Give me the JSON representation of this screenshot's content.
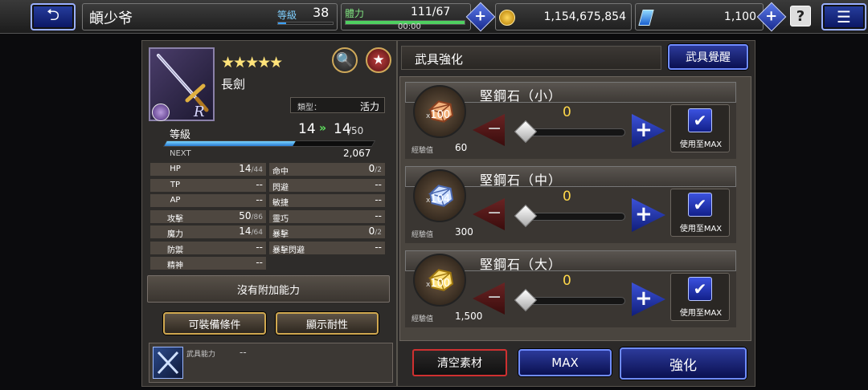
{
  "header": {
    "back_icon": "back-arrow-icon",
    "player_name": "頔少爷",
    "level_label": "等級",
    "level_value": "38",
    "exp_fraction": 0.15,
    "stamina_label": "體力",
    "stamina_value": "111/67",
    "stamina_timer": "00:00",
    "stamina_fraction": 1.0,
    "gil_value": "1,154,675,854",
    "gem_value": "1,100",
    "help_label": "?",
    "menu_icon": "hamburger-menu-icon"
  },
  "weapon": {
    "rarity_stars": "★★★★★",
    "name": "長劍",
    "type_label": "類型：",
    "type_value": "活力",
    "level_label": "等級",
    "level_current": "14",
    "level_arrow": "»",
    "level_new": "14",
    "level_max": "/50",
    "exp_fraction": 0.62,
    "next_label": "NEXT",
    "next_value": "2,067"
  },
  "stats_left": [
    {
      "label": "HP",
      "value": "14",
      "max": "/44"
    },
    {
      "label": "TP",
      "value": "--",
      "max": ""
    },
    {
      "label": "AP",
      "value": "--",
      "max": ""
    },
    {
      "label": "攻擊",
      "value": "50",
      "max": "/86"
    },
    {
      "label": "魔力",
      "value": "14",
      "max": "/64"
    },
    {
      "label": "防禦",
      "value": "--",
      "max": ""
    },
    {
      "label": "精神",
      "value": "--",
      "max": ""
    }
  ],
  "stats_right": [
    {
      "label": "命中",
      "value": "0",
      "max": "/2"
    },
    {
      "label": "閃避",
      "value": "--",
      "max": ""
    },
    {
      "label": "敏捷",
      "value": "--",
      "max": ""
    },
    {
      "label": "靈巧",
      "value": "--",
      "max": ""
    },
    {
      "label": "暴擊",
      "value": "0",
      "max": "/2"
    },
    {
      "label": "暴擊閃避",
      "value": "--",
      "max": ""
    }
  ],
  "no_ability_text": "沒有附加能力",
  "equip_condition_label": "可裝備條件",
  "show_durability_label": "顯示耐性",
  "ability_label": "武具能力",
  "ability_value": "--",
  "enhance": {
    "title": "武具強化",
    "awaken_label": "武具覺醒",
    "materials": [
      {
        "name": "堅鋼石（小）",
        "count": "100",
        "count_prefix": "x",
        "exp_label": "經驗值",
        "exp_value": "60",
        "qty": "0",
        "use_max_label": "使用至MAX",
        "ore_color_a": "#f2b07a",
        "ore_color_b": "#8a4020"
      },
      {
        "name": "堅鋼石（中）",
        "count": "104",
        "count_prefix": "x",
        "exp_label": "經驗值",
        "exp_value": "300",
        "qty": "0",
        "use_max_label": "使用至MAX",
        "ore_color_a": "#cfe0ff",
        "ore_color_b": "#4a68b0"
      },
      {
        "name": "堅鋼石（大）",
        "count": "100",
        "count_prefix": "x",
        "exp_label": "經驗值",
        "exp_value": "1,500",
        "qty": "0",
        "use_max_label": "使用至MAX",
        "ore_color_a": "#ffe27a",
        "ore_color_b": "#a07810"
      }
    ],
    "clear_label": "清空素材",
    "max_label": "MAX",
    "enhance_label": "強化"
  },
  "colors": {
    "accent_blue": "#2c3a9a",
    "gold_text": "#ffd84a",
    "level_arrow": "#5ee05e",
    "clear_border": "#cf3030"
  }
}
